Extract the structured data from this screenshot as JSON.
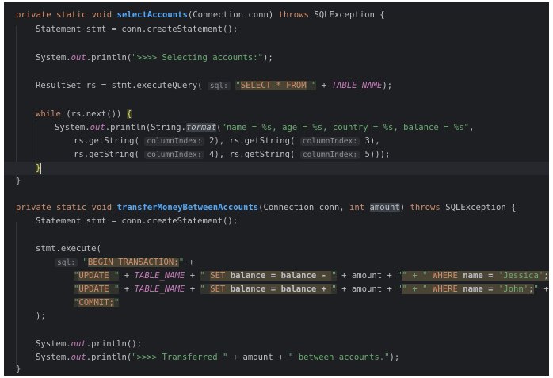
{
  "editor": {
    "lines": {
      "l1": {
        "kw1": "private static void ",
        "fn": "selectAccounts",
        "args": "(Connection conn) ",
        "kw2": "throws",
        "rest": " SQLException {"
      },
      "l2": {
        "text": "Statement stmt = conn.createStatement();"
      },
      "l4": {
        "pre": "System.",
        "field": "out",
        "call": ".println(",
        "str": "\">>>> Selecting accounts:\"",
        "end": ");"
      },
      "l6": {
        "pre": "ResultSet rs = stmt.executeQuery( ",
        "hint": "sql:",
        "q1": "\"",
        "sql_kw": "SELECT * FROM",
        "q2": " \"",
        "plus": " + ",
        "const": "TABLE_NAME",
        "end": ");"
      },
      "l8": {
        "kw": "while",
        "cond": " (rs.next()) ",
        "brace": "{"
      },
      "l9": {
        "pre": "System.",
        "field": "out",
        "call": ".println(String.",
        "method": "format",
        "paren": "(",
        "str": "\"name = %s, age = %s, country = %s, balance = %s\"",
        "comma": ","
      },
      "l10": {
        "a": "rs.getString( ",
        "hint1": "columnIndex:",
        "v1": " 2), rs.getString( ",
        "hint2": "columnIndex:",
        "v2": " 3),"
      },
      "l11": {
        "a": "rs.getString( ",
        "hint1": "columnIndex:",
        "v1": " 4), rs.getString( ",
        "hint2": "columnIndex:",
        "v2": " 5)));"
      },
      "l12": {
        "brace": "}"
      },
      "l13": {
        "brace": "}"
      },
      "l15": {
        "kw1": "private static void ",
        "fn": "transferMoneyBetweenAccounts",
        "args": "(Connection conn, ",
        "kw_int": "int",
        "space": " ",
        "param": "amount",
        "close": ") ",
        "kw2": "throws",
        "rest": " SQLException {"
      },
      "l16": {
        "text": "Statement stmt = conn.createStatement();"
      },
      "l18": {
        "text": "stmt.execute("
      },
      "l19": {
        "hint": "sql:",
        "q": " \"",
        "sql": "BEGIN TRANSACTION;",
        "qe": "\"",
        "plus": " +"
      },
      "l20": {
        "q1": "\"",
        "kw1": "UPDATE",
        "q2": " \"",
        "p1": " + ",
        "const": "TABLE_NAME",
        "p2": " + ",
        "q3": "\" ",
        "kw2": "SET",
        "set": " balance = balance - ",
        "q4": "\"",
        "p3": " + amount + ",
        "q5": "\"",
        "q6": "\" + \"",
        "where_sp": " ",
        "kw3": "WHERE",
        "cond": " name = ",
        "val": "'Jessica'",
        "semi": ";",
        "q7": "\"",
        "p4": " +"
      },
      "l21": {
        "q1": "\"",
        "kw1": "UPDATE",
        "q2": " \"",
        "p1": " + ",
        "const": "TABLE_NAME",
        "p2": " + ",
        "q3": "\" ",
        "kw2": "SET",
        "set": " balance = balance + ",
        "q4": "\"",
        "p3": " + amount + ",
        "q5": "\"",
        "q6": "\" + \"",
        "where_sp": " ",
        "kw3": "WHERE",
        "cond": " name = ",
        "val": "'John'",
        "semi": ";",
        "q7": "\"",
        "p4": " +"
      },
      "l22": {
        "q1": "\"",
        "kw": "COMMIT;",
        "q2": "\""
      },
      "l23": {
        "text": ");"
      },
      "l25": {
        "pre": "System.",
        "field": "out",
        "end": ".println();"
      },
      "l26": {
        "pre": "System.",
        "field": "out",
        "call": ".println(",
        "str1": "\">>>> Transferred \"",
        "mid": " + amount + ",
        "str2": "\" between accounts.\"",
        "end": ");"
      },
      "l27": {
        "brace": "}"
      }
    },
    "colors": {
      "background": "#1e1f22",
      "keyword": "#cf8e6d",
      "function": "#56a8f5",
      "string": "#6aab73",
      "constant": "#c77dbb",
      "text": "#bcbec4"
    }
  }
}
